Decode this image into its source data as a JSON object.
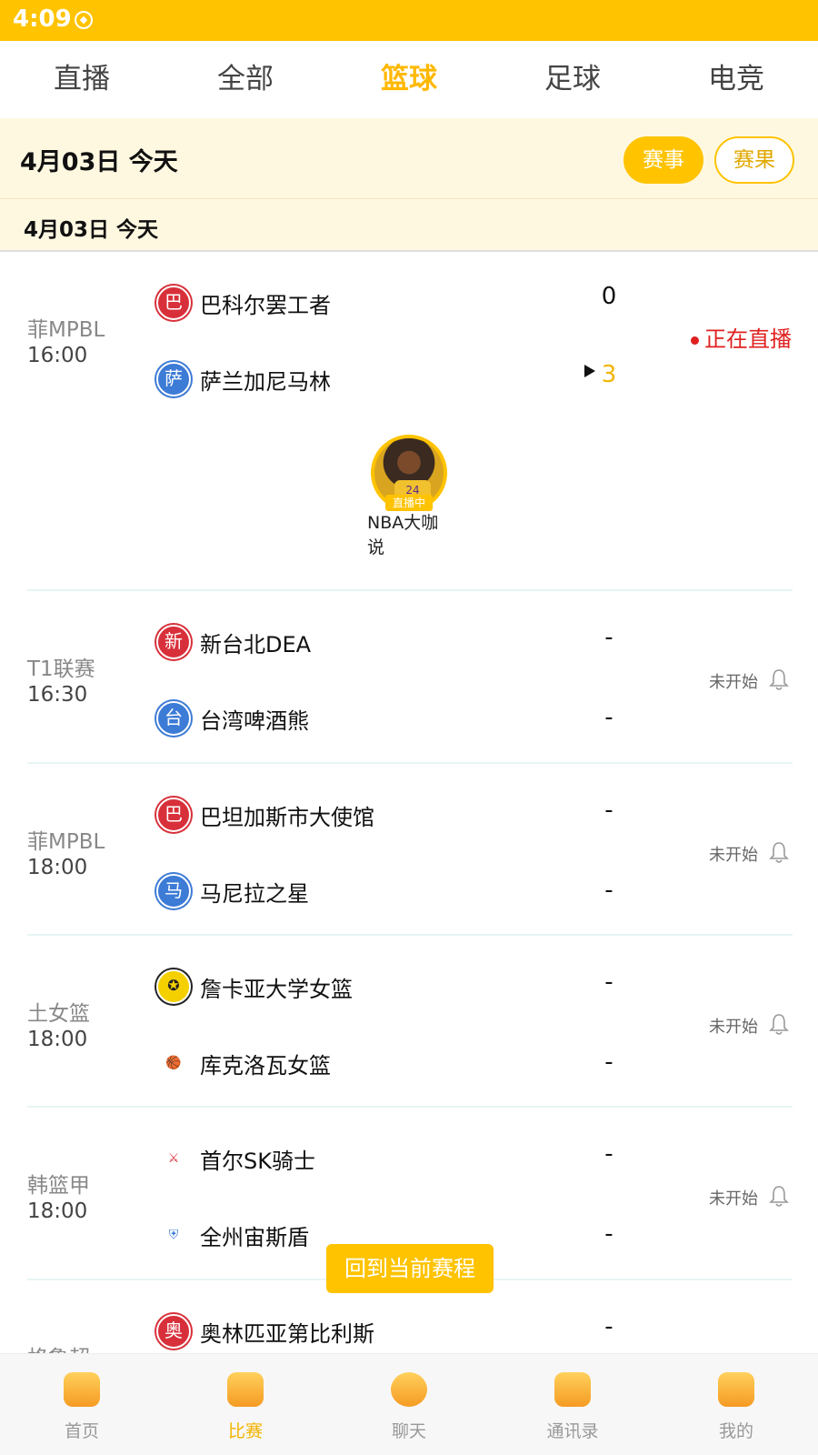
{
  "status_bar": {
    "time": "4:09"
  },
  "tabs": [
    {
      "label": "直播"
    },
    {
      "label": "全部"
    },
    {
      "label": "篮球"
    },
    {
      "label": "足球"
    },
    {
      "label": "电竞"
    }
  ],
  "date_header": {
    "label": "4月03日  今天",
    "schedule_btn": "赛事",
    "result_btn": "赛果"
  },
  "sub_date": {
    "label": "4月03日   今天"
  },
  "matches": [
    {
      "league": "菲MPBL",
      "time": "16:00",
      "home": {
        "badge": "巴",
        "name": "巴科尔罢工者",
        "score": "0"
      },
      "away": {
        "badge": "萨",
        "name": "萨兰加尼马林",
        "score": "3"
      },
      "status": "正在直播",
      "anchor": {
        "tag": "直播中",
        "name": "NBA大咖说"
      }
    },
    {
      "league": "T1联赛",
      "time": "16:30",
      "home": {
        "badge": "新",
        "name": "新台北DEA",
        "score": "-"
      },
      "away": {
        "badge": "台",
        "name": "台湾啤酒熊",
        "score": "-"
      },
      "status": "未开始"
    },
    {
      "league": "菲MPBL",
      "time": "18:00",
      "home": {
        "badge": "巴",
        "name": "巴坦加斯市大使馆",
        "score": "-"
      },
      "away": {
        "badge": "马",
        "name": "马尼拉之星",
        "score": "-"
      },
      "status": "未开始"
    },
    {
      "league": "土女篮",
      "time": "18:00",
      "home": {
        "badge": "",
        "name": "詹卡亚大学女篮",
        "score": "-"
      },
      "away": {
        "badge": "",
        "name": "库克洛瓦女篮",
        "score": "-"
      },
      "status": "未开始"
    },
    {
      "league": "韩篮甲",
      "time": "18:00",
      "home": {
        "badge": "",
        "name": "首尔SK骑士",
        "score": "-"
      },
      "away": {
        "badge": "",
        "name": "全州宙斯盾",
        "score": "-"
      },
      "status": "未开始"
    },
    {
      "league": "格鲁超",
      "time": "",
      "home": {
        "badge": "奥",
        "name": "奥林匹亚第比利斯",
        "score": "-"
      }
    }
  ],
  "float_button": "回到当前赛程",
  "bottom_nav": [
    {
      "label": "首页",
      "icon": "home-icon"
    },
    {
      "label": "比赛",
      "icon": "match-icon"
    },
    {
      "label": "聊天",
      "icon": "chat-icon"
    },
    {
      "label": "通讯录",
      "icon": "contacts-icon"
    },
    {
      "label": "我的",
      "icon": "profile-icon"
    }
  ],
  "colors": {
    "accent": "#FFC300",
    "live": "#E02020",
    "score_highlight": "#F2B400"
  }
}
